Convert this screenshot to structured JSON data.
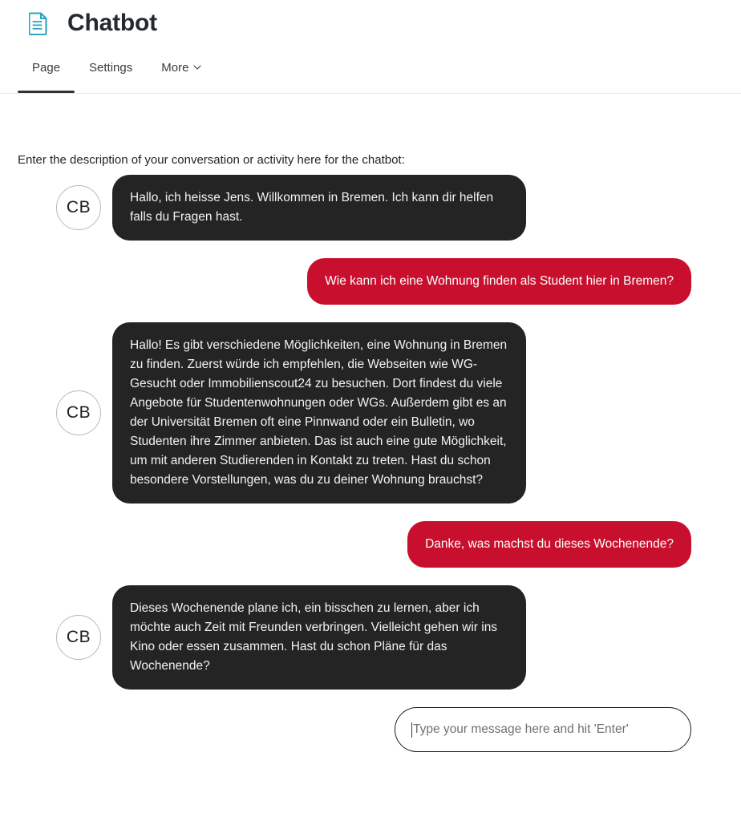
{
  "header": {
    "icon": "document-icon",
    "icon_color": "#2aa5bf",
    "title": "Chatbot"
  },
  "tabs": [
    {
      "label": "Page",
      "active": true,
      "has_chevron": false
    },
    {
      "label": "Settings",
      "active": false,
      "has_chevron": false
    },
    {
      "label": "More",
      "active": false,
      "has_chevron": true
    }
  ],
  "main": {
    "intro_label": "Enter the description of your conversation or activity here for the chatbot:",
    "bot_avatar_initials": "CB",
    "colors": {
      "bot_bubble": "#242424",
      "user_bubble": "#c8102e",
      "accent_icon": "#2aa5bf",
      "tab_underline": "#323130"
    },
    "messages": [
      {
        "sender": "bot",
        "avatar": "CB",
        "text": "Hallo, ich heisse Jens. Willkommen in Bremen. Ich kann dir helfen falls du Fragen hast."
      },
      {
        "sender": "user",
        "text": "Wie kann ich eine Wohnung finden als Student hier in Bremen?"
      },
      {
        "sender": "bot",
        "avatar": "CB",
        "text": "Hallo! Es gibt verschiedene Möglichkeiten, eine Wohnung in Bremen zu finden. Zuerst würde ich empfehlen, die Webseiten wie WG-Gesucht oder Immobilienscout24 zu besuchen. Dort findest du viele Angebote für Studentenwohnungen oder WGs. Außerdem gibt es an der Universität Bremen oft eine Pinnwand oder ein Bulletin, wo Studenten ihre Zimmer anbieten. Das ist auch eine gute Möglichkeit, um mit anderen Studierenden in Kontakt zu treten. Hast du schon besondere Vorstellungen, was du zu deiner Wohnung brauchst?"
      },
      {
        "sender": "user",
        "text": "Danke, was machst du dieses Wochenende?"
      },
      {
        "sender": "bot",
        "avatar": "CB",
        "text": "Dieses Wochenende plane ich, ein bisschen zu lernen, aber ich möchte auch Zeit mit Freunden verbringen. Vielleicht gehen wir ins Kino oder essen zusammen. Hast du schon Pläne für das Wochenende?"
      }
    ],
    "composer": {
      "placeholder": "Type your message here and hit 'Enter'",
      "value": ""
    }
  }
}
